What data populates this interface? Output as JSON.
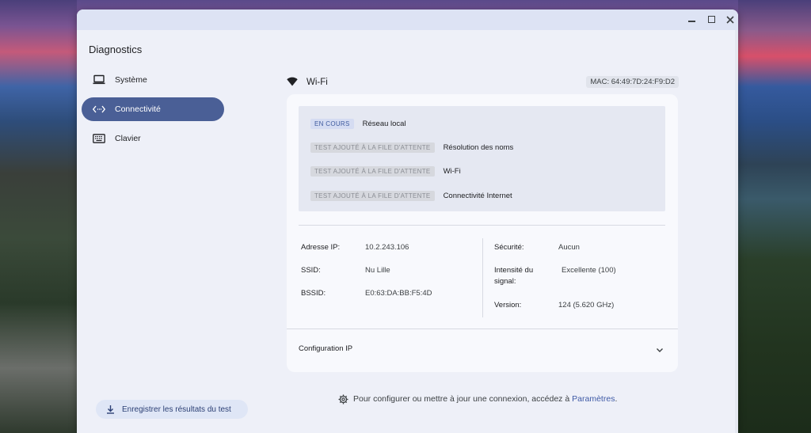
{
  "app": {
    "title": "Diagnostics"
  },
  "nav": {
    "items": [
      {
        "label": "Système",
        "icon": "laptop-icon"
      },
      {
        "label": "Connectivité",
        "icon": "code-arrows-icon",
        "active": true
      },
      {
        "label": "Clavier",
        "icon": "keyboard-icon"
      }
    ]
  },
  "save_button": {
    "label": "Enregistrer les résultats du test"
  },
  "network": {
    "title": "Wi-Fi",
    "mac": "MAC: 64:49:7D:24:F9:D2"
  },
  "tests": [
    {
      "status": "EN COURS",
      "label": "Réseau local"
    },
    {
      "status": "TEST AJOUTÉ À LA FILE D'ATTENTE",
      "label": "Résolution des noms"
    },
    {
      "status": "TEST AJOUTÉ À LA FILE D'ATTENTE",
      "label": "Wi-Fi"
    },
    {
      "status": "TEST AJOUTÉ À LA FILE D'ATTENTE",
      "label": "Connectivité Internet"
    }
  ],
  "details": {
    "ip_label": "Adresse IP:",
    "ip_value": "10.2.243.106",
    "ssid_label": "SSID:",
    "ssid_value": "Nu Lille",
    "bssid_label": "BSSID:",
    "bssid_value": "E0:63:DA:BB:F5:4D",
    "security_label": "Sécurité:",
    "security_value": "Aucun",
    "signal_label_1": "Intensité du",
    "signal_label_2": "signal:",
    "signal_value": "Excellente (100)",
    "version_label": "Version:",
    "version_value": "124 (5.620 GHz)"
  },
  "config": {
    "label": "Configuration IP"
  },
  "footer": {
    "hint": "Pour configurer ou mettre à jour une connexion, accédez à",
    "link": "Paramètres",
    "period": "."
  },
  "colors": {
    "accent": "#4a5f96",
    "link": "#3f5aa6",
    "running_badge": "#d5dcf2",
    "queued_badge": "#d6d8de"
  }
}
